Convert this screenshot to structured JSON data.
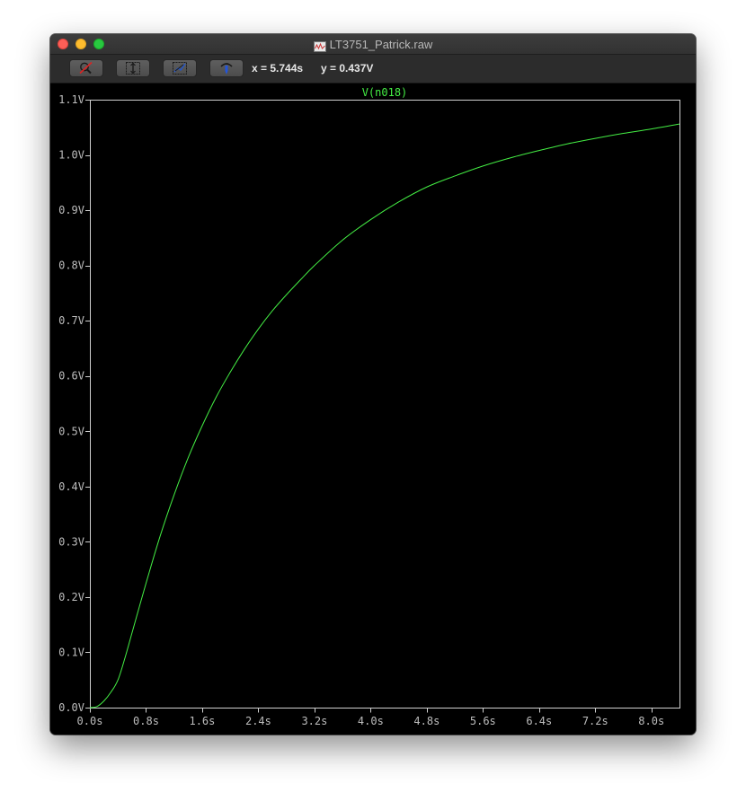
{
  "window": {
    "title": "LT3751_Patrick.raw",
    "doc_icon": "waveform-document-icon"
  },
  "toolbar": {
    "buttons": [
      {
        "name": "zoom-cancel-button",
        "icon": "magnifier-cancel-icon"
      },
      {
        "name": "autorange-y-button",
        "icon": "autorange-y-icon"
      },
      {
        "name": "autorange-xy-button",
        "icon": "autorange-xy-icon"
      },
      {
        "name": "probe-button",
        "icon": "probe-icon"
      }
    ],
    "cursor_x": "x = 5.744s",
    "cursor_y": "y = 0.437V"
  },
  "colors": {
    "trace": "#44ee44",
    "grid_frame": "#d0d0d0",
    "background": "#000000",
    "tick_text": "#bdbdbd"
  },
  "chart_data": {
    "type": "line",
    "title": "V(n018)",
    "xlabel": "",
    "ylabel": "",
    "xlim": [
      0,
      8.4
    ],
    "ylim": [
      0,
      1.1
    ],
    "x_ticks": [
      "0.0s",
      "0.8s",
      "1.6s",
      "2.4s",
      "3.2s",
      "4.0s",
      "4.8s",
      "5.6s",
      "6.4s",
      "7.2s",
      "8.0s"
    ],
    "x_tick_values": [
      0,
      0.8,
      1.6,
      2.4,
      3.2,
      4.0,
      4.8,
      5.6,
      6.4,
      7.2,
      8.0
    ],
    "y_ticks": [
      "0.0V",
      "0.1V",
      "0.2V",
      "0.3V",
      "0.4V",
      "0.5V",
      "0.6V",
      "0.7V",
      "0.8V",
      "0.9V",
      "1.0V",
      "1.1V"
    ],
    "y_tick_values": [
      0,
      0.1,
      0.2,
      0.3,
      0.4,
      0.5,
      0.6,
      0.7,
      0.8,
      0.9,
      1.0,
      1.1
    ],
    "grid": false,
    "series": [
      {
        "name": "V(n018)",
        "x": [
          0,
          0.1,
          0.2,
          0.3,
          0.4,
          0.5,
          0.6,
          0.8,
          1.0,
          1.2,
          1.4,
          1.6,
          1.8,
          2.0,
          2.2,
          2.4,
          2.6,
          2.8,
          3.0,
          3.2,
          3.6,
          4.0,
          4.4,
          4.8,
          5.2,
          5.6,
          6.0,
          6.4,
          6.8,
          7.2,
          7.6,
          8.0,
          8.4
        ],
        "y": [
          0,
          0.002,
          0.012,
          0.028,
          0.05,
          0.09,
          0.135,
          0.225,
          0.31,
          0.385,
          0.452,
          0.51,
          0.562,
          0.607,
          0.648,
          0.685,
          0.718,
          0.747,
          0.774,
          0.8,
          0.846,
          0.883,
          0.915,
          0.942,
          0.962,
          0.98,
          0.995,
          1.008,
          1.02,
          1.03,
          1.039,
          1.047,
          1.056
        ]
      }
    ]
  }
}
